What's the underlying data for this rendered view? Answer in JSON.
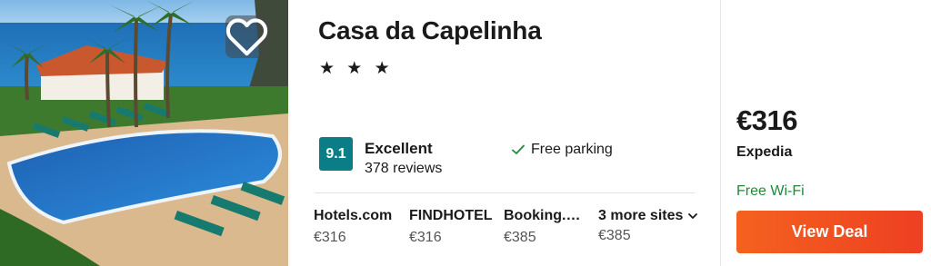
{
  "hotel": {
    "name": "Casa da Capelinha",
    "stars": "★ ★ ★",
    "image_icon": "hotel-photo",
    "favorite_icon": "heart-outline-icon"
  },
  "rating": {
    "score": "9.1",
    "label": "Excellent",
    "reviews": "378 reviews",
    "color": "#0a7d86"
  },
  "amenity": {
    "icon": "checkmark-icon",
    "label": "Free parking"
  },
  "sites": [
    {
      "name": "Hotels.com",
      "price": "€316"
    },
    {
      "name": "FINDHOTEL",
      "price": "€316"
    },
    {
      "name": "Booking.com",
      "price": "€385"
    }
  ],
  "more_sites": {
    "label": "3 more sites",
    "price": "€385",
    "icon": "chevron-down-icon"
  },
  "deal": {
    "price": "€316",
    "provider": "Expedia",
    "perk": "Free Wi-Fi",
    "button_label": "View Deal",
    "button_color": "#f0521f",
    "perk_color": "#1e8a3a"
  }
}
